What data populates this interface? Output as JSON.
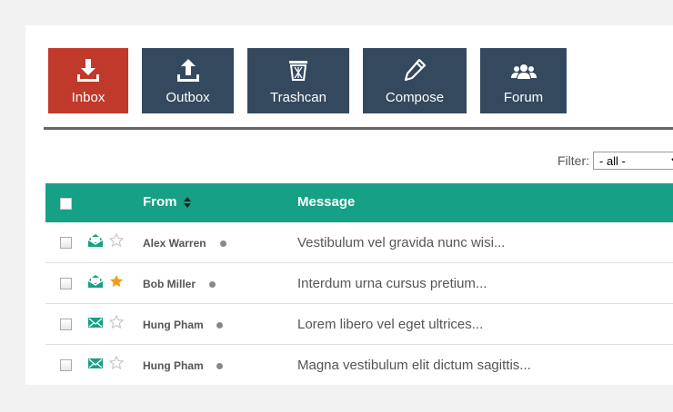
{
  "toolbar": {
    "tabs": [
      {
        "label": "Inbox",
        "icon": "download-icon",
        "active": true
      },
      {
        "label": "Outbox",
        "icon": "upload-icon",
        "active": false
      },
      {
        "label": "Trashcan",
        "icon": "trash-icon",
        "active": false
      },
      {
        "label": "Compose",
        "icon": "pencil-icon",
        "active": false
      },
      {
        "label": "Forum",
        "icon": "users-icon",
        "active": false
      }
    ]
  },
  "filter": {
    "label": "Filter:",
    "value": "- all -"
  },
  "table": {
    "headers": {
      "from": "From",
      "message": "Message"
    },
    "rows": [
      {
        "from": "Alex Warren",
        "message": "Vestibulum vel gravida nunc wisi...",
        "mail_icon": "envelope-open-icon",
        "starred": false
      },
      {
        "from": "Bob Miller",
        "message": "Interdum urna cursus pretium...",
        "mail_icon": "envelope-open-icon",
        "starred": true
      },
      {
        "from": "Hung Pham",
        "message": "Lorem libero vel eget ultrices...",
        "mail_icon": "envelope-icon",
        "starred": false
      },
      {
        "from": "Hung Pham",
        "message": "Magna vestibulum elit dictum sagittis...",
        "mail_icon": "envelope-icon",
        "starred": false
      }
    ]
  },
  "colors": {
    "active_tab": "#c0392b",
    "tab": "#34495e",
    "header": "#16a085",
    "star_active": "#f39c12"
  }
}
